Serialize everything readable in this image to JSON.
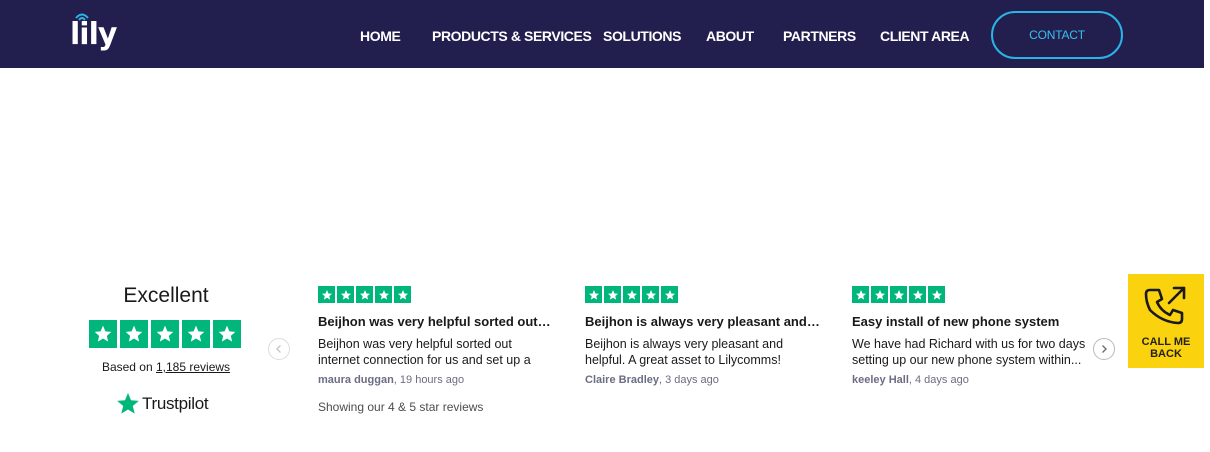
{
  "header": {
    "logo_text": "lily",
    "nav": [
      "HOME",
      "PRODUCTS & SERVICES",
      "SOLUTIONS",
      "ABOUT",
      "PARTNERS",
      "CLIENT AREA"
    ],
    "contact_label": "CONTACT"
  },
  "trustpilot": {
    "rating_label": "Excellent",
    "based_on_prefix": "Based on",
    "review_count": "1,185 reviews",
    "brand": "Trustpilot",
    "star_color": "#00b67a",
    "reviews": [
      {
        "stars": 5,
        "title": "Beijhon was very helpful sorted out internet connection for us and set up a",
        "body": "Beijhon was very helpful sorted out internet connection for us and set up a",
        "author": "maura duggan",
        "time": ", 19 hours ago"
      },
      {
        "stars": 5,
        "title": "Beijhon is always very pleasant and helpful. A great asset to Lilycomms!",
        "body": "Beijhon is always very pleasant and helpful. A great asset to Lilycomms!",
        "author": "Claire Bradley",
        "time": ", 3 days ago"
      },
      {
        "stars": 5,
        "title": "Easy install of new phone system",
        "body": "We have had Richard with us for two days setting up our new phone system within...",
        "author": "keeley Hall",
        "time": ", 4 days ago"
      }
    ],
    "showing_text": "Showing our 4 & 5 star reviews"
  },
  "callback": {
    "label_line1": "CALL ME",
    "label_line2": "BACK"
  },
  "colors": {
    "header_bg": "#221f4f",
    "contact_accent": "#2ab3e6",
    "callback_bg": "#fbd20e"
  }
}
